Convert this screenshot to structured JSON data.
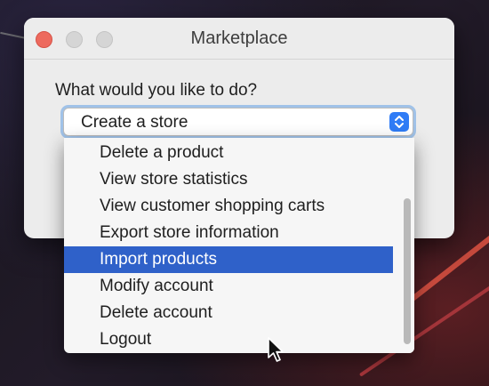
{
  "window": {
    "title": "Marketplace"
  },
  "form": {
    "prompt": "What would you like to do?"
  },
  "combo": {
    "selected_value": "Create a store"
  },
  "menu": {
    "items": [
      {
        "label": "Delete a product",
        "selected": false
      },
      {
        "label": "View store statistics",
        "selected": false
      },
      {
        "label": "View customer shopping carts",
        "selected": false
      },
      {
        "label": "Export store information",
        "selected": false
      },
      {
        "label": "Import products",
        "selected": true
      },
      {
        "label": "Modify account",
        "selected": false
      },
      {
        "label": "Delete account",
        "selected": false
      },
      {
        "label": "Logout",
        "selected": false
      }
    ]
  },
  "colors": {
    "selection": "#2f61c9",
    "accent": "#2f7cf6",
    "close_button": "#ed6a5e"
  },
  "icons": {
    "combo_arrows": "chevron-up-down-icon",
    "cursor": "mouse-pointer-icon"
  }
}
